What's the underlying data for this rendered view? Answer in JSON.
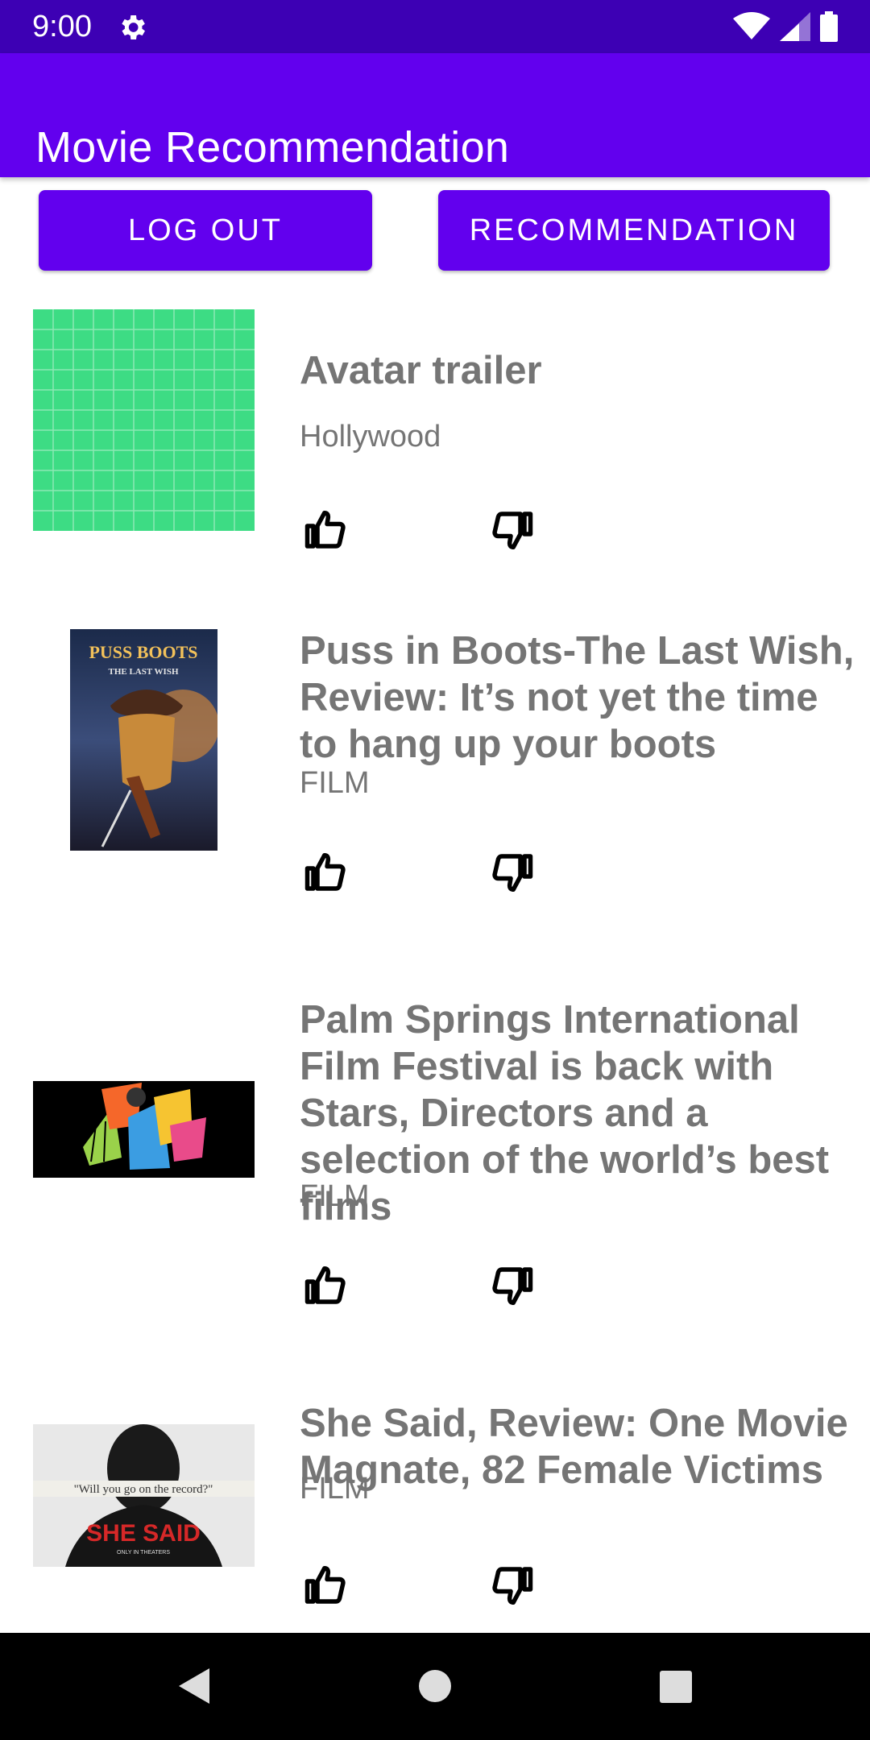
{
  "status_bar": {
    "time": "9:00",
    "icons": [
      "settings-icon",
      "wifi-icon",
      "signal-icon",
      "battery-icon"
    ]
  },
  "app_bar": {
    "title": "Movie Recommendation"
  },
  "buttons": {
    "logout": "LOG OUT",
    "recommendation": "RECOMMENDATION"
  },
  "items": [
    {
      "title": "Avatar trailer",
      "category": "Hollywood",
      "thumbnail": "green-grid-placeholder"
    },
    {
      "title": "Puss in Boots-The Last Wish, Review: It’s not yet the time to hang up your boots",
      "category": "FILM",
      "thumbnail": "puss-in-boots-poster",
      "poster_text_1": "PUSS BOOTS",
      "poster_text_2": "THE LAST WISH"
    },
    {
      "title": "Palm Springs International Film Festival is back with Stars, Directors and a selection of the world’s best films",
      "category": "FILM",
      "thumbnail": "palm-springs-festival-banner"
    },
    {
      "title": "She Said, Review: One Movie Magnate, 82 Female Victims",
      "category": "FILM",
      "thumbnail": "she-said-poster",
      "poster_quote": "\"Will you go on the record?\"",
      "poster_title": "SHE SAID",
      "poster_subtitle": "ONLY IN THEATERS"
    }
  ],
  "colors": {
    "primary": "#6200ee",
    "primary_dark": "#3d00b4",
    "text_secondary": "#757575",
    "placeholder_green": "#3ddc84"
  },
  "nav": {
    "icons": [
      "back-icon",
      "home-icon",
      "recents-icon"
    ]
  }
}
